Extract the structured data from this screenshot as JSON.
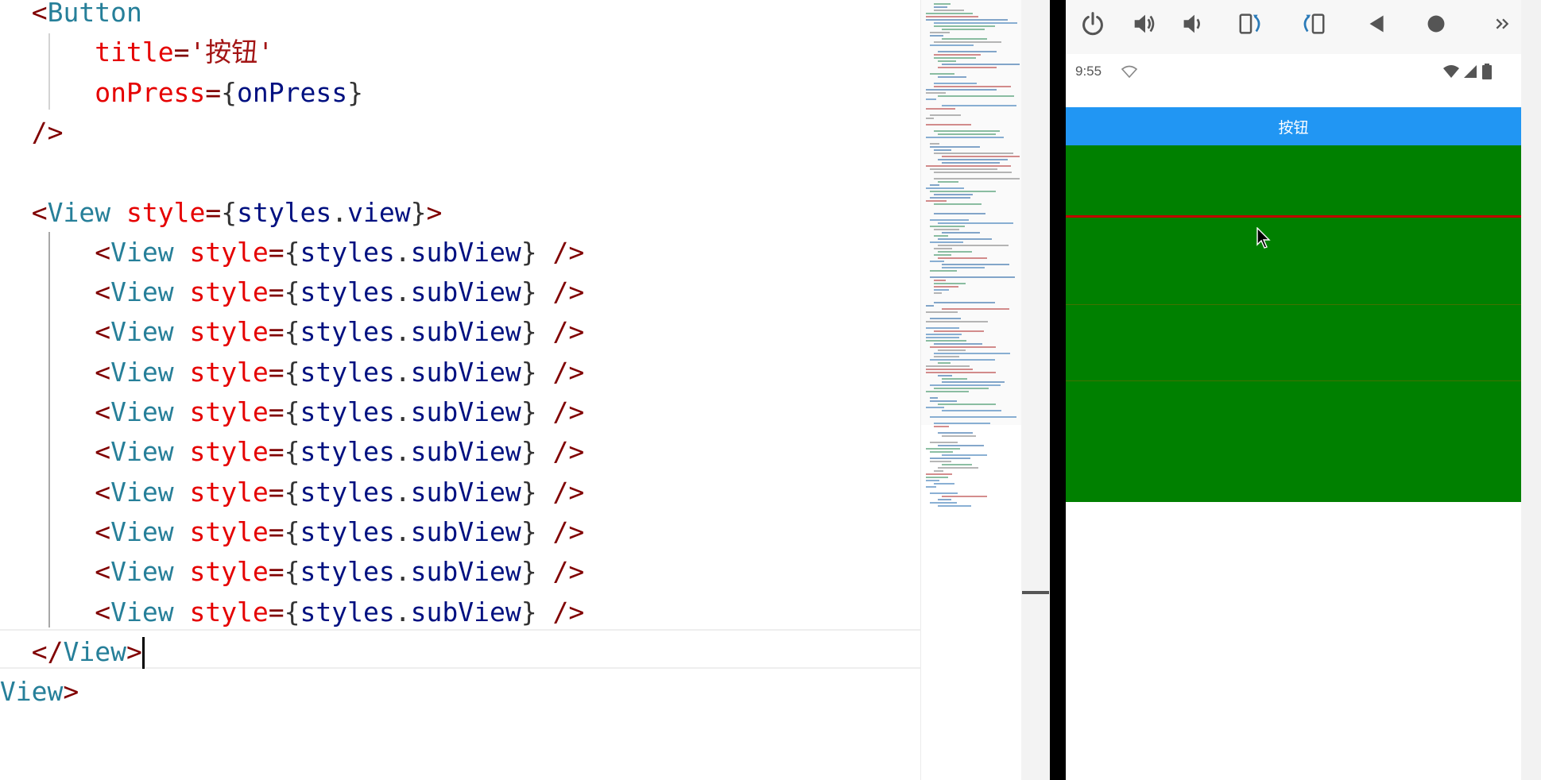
{
  "editor": {
    "lines": [
      {
        "indent": "  ",
        "tokens": [
          [
            "punc",
            "<"
          ],
          [
            "tag",
            "Button"
          ]
        ]
      },
      {
        "indent": "      ",
        "tokens": [
          [
            "attr",
            "title"
          ],
          [
            "punc",
            "="
          ],
          [
            "str",
            "'按钮'"
          ]
        ]
      },
      {
        "indent": "      ",
        "tokens": [
          [
            "attr",
            "onPress"
          ],
          [
            "punc",
            "="
          ],
          [
            "plain",
            "{"
          ],
          [
            "var",
            "onPress"
          ],
          [
            "plain",
            "}"
          ]
        ]
      },
      {
        "indent": "  ",
        "tokens": [
          [
            "punc",
            "/>"
          ]
        ]
      },
      {
        "indent": "",
        "tokens": []
      },
      {
        "indent": "  ",
        "tokens": [
          [
            "punc",
            "<"
          ],
          [
            "tag",
            "View"
          ],
          [
            "plain",
            " "
          ],
          [
            "attr",
            "style"
          ],
          [
            "punc",
            "="
          ],
          [
            "plain",
            "{"
          ],
          [
            "var",
            "styles"
          ],
          [
            "plain",
            "."
          ],
          [
            "var",
            "view"
          ],
          [
            "plain",
            "}"
          ],
          [
            "punc",
            ">"
          ]
        ]
      },
      {
        "indent": "      ",
        "tokens": [
          [
            "punc",
            "<"
          ],
          [
            "tag",
            "View"
          ],
          [
            "plain",
            " "
          ],
          [
            "attr",
            "style"
          ],
          [
            "punc",
            "="
          ],
          [
            "plain",
            "{"
          ],
          [
            "var",
            "styles"
          ],
          [
            "plain",
            "."
          ],
          [
            "var",
            "subView"
          ],
          [
            "plain",
            "}"
          ],
          [
            "plain",
            " "
          ],
          [
            "punc",
            "/>"
          ]
        ]
      },
      {
        "indent": "      ",
        "tokens": [
          [
            "punc",
            "<"
          ],
          [
            "tag",
            "View"
          ],
          [
            "plain",
            " "
          ],
          [
            "attr",
            "style"
          ],
          [
            "punc",
            "="
          ],
          [
            "plain",
            "{"
          ],
          [
            "var",
            "styles"
          ],
          [
            "plain",
            "."
          ],
          [
            "var",
            "subView"
          ],
          [
            "plain",
            "}"
          ],
          [
            "plain",
            " "
          ],
          [
            "punc",
            "/>"
          ]
        ]
      },
      {
        "indent": "      ",
        "tokens": [
          [
            "punc",
            "<"
          ],
          [
            "tag",
            "View"
          ],
          [
            "plain",
            " "
          ],
          [
            "attr",
            "style"
          ],
          [
            "punc",
            "="
          ],
          [
            "plain",
            "{"
          ],
          [
            "var",
            "styles"
          ],
          [
            "plain",
            "."
          ],
          [
            "var",
            "subView"
          ],
          [
            "plain",
            "}"
          ],
          [
            "plain",
            " "
          ],
          [
            "punc",
            "/>"
          ]
        ]
      },
      {
        "indent": "      ",
        "tokens": [
          [
            "punc",
            "<"
          ],
          [
            "tag",
            "View"
          ],
          [
            "plain",
            " "
          ],
          [
            "attr",
            "style"
          ],
          [
            "punc",
            "="
          ],
          [
            "plain",
            "{"
          ],
          [
            "var",
            "styles"
          ],
          [
            "plain",
            "."
          ],
          [
            "var",
            "subView"
          ],
          [
            "plain",
            "}"
          ],
          [
            "plain",
            " "
          ],
          [
            "punc",
            "/>"
          ]
        ]
      },
      {
        "indent": "      ",
        "tokens": [
          [
            "punc",
            "<"
          ],
          [
            "tag",
            "View"
          ],
          [
            "plain",
            " "
          ],
          [
            "attr",
            "style"
          ],
          [
            "punc",
            "="
          ],
          [
            "plain",
            "{"
          ],
          [
            "var",
            "styles"
          ],
          [
            "plain",
            "."
          ],
          [
            "var",
            "subView"
          ],
          [
            "plain",
            "}"
          ],
          [
            "plain",
            " "
          ],
          [
            "punc",
            "/>"
          ]
        ]
      },
      {
        "indent": "      ",
        "tokens": [
          [
            "punc",
            "<"
          ],
          [
            "tag",
            "View"
          ],
          [
            "plain",
            " "
          ],
          [
            "attr",
            "style"
          ],
          [
            "punc",
            "="
          ],
          [
            "plain",
            "{"
          ],
          [
            "var",
            "styles"
          ],
          [
            "plain",
            "."
          ],
          [
            "var",
            "subView"
          ],
          [
            "plain",
            "}"
          ],
          [
            "plain",
            " "
          ],
          [
            "punc",
            "/>"
          ]
        ]
      },
      {
        "indent": "      ",
        "tokens": [
          [
            "punc",
            "<"
          ],
          [
            "tag",
            "View"
          ],
          [
            "plain",
            " "
          ],
          [
            "attr",
            "style"
          ],
          [
            "punc",
            "="
          ],
          [
            "plain",
            "{"
          ],
          [
            "var",
            "styles"
          ],
          [
            "plain",
            "."
          ],
          [
            "var",
            "subView"
          ],
          [
            "plain",
            "}"
          ],
          [
            "plain",
            " "
          ],
          [
            "punc",
            "/>"
          ]
        ]
      },
      {
        "indent": "      ",
        "tokens": [
          [
            "punc",
            "<"
          ],
          [
            "tag",
            "View"
          ],
          [
            "plain",
            " "
          ],
          [
            "attr",
            "style"
          ],
          [
            "punc",
            "="
          ],
          [
            "plain",
            "{"
          ],
          [
            "var",
            "styles"
          ],
          [
            "plain",
            "."
          ],
          [
            "var",
            "subView"
          ],
          [
            "plain",
            "}"
          ],
          [
            "plain",
            " "
          ],
          [
            "punc",
            "/>"
          ]
        ]
      },
      {
        "indent": "      ",
        "tokens": [
          [
            "punc",
            "<"
          ],
          [
            "tag",
            "View"
          ],
          [
            "plain",
            " "
          ],
          [
            "attr",
            "style"
          ],
          [
            "punc",
            "="
          ],
          [
            "plain",
            "{"
          ],
          [
            "var",
            "styles"
          ],
          [
            "plain",
            "."
          ],
          [
            "var",
            "subView"
          ],
          [
            "plain",
            "}"
          ],
          [
            "plain",
            " "
          ],
          [
            "punc",
            "/>"
          ]
        ]
      },
      {
        "indent": "      ",
        "tokens": [
          [
            "punc",
            "<"
          ],
          [
            "tag",
            "View"
          ],
          [
            "plain",
            " "
          ],
          [
            "attr",
            "style"
          ],
          [
            "punc",
            "="
          ],
          [
            "plain",
            "{"
          ],
          [
            "var",
            "styles"
          ],
          [
            "plain",
            "."
          ],
          [
            "var",
            "subView"
          ],
          [
            "plain",
            "}"
          ],
          [
            "plain",
            " "
          ],
          [
            "punc",
            "/>"
          ]
        ]
      },
      {
        "indent": "  ",
        "tokens": [
          [
            "punc",
            "</"
          ],
          [
            "tag",
            "View"
          ],
          [
            "punc",
            ">"
          ]
        ],
        "cursor": true
      },
      {
        "indent": "",
        "tokens": [
          [
            "punc",
            "/"
          ],
          [
            "tag",
            "View"
          ],
          [
            "punc",
            ">"
          ]
        ]
      }
    ]
  },
  "emulator": {
    "toolbar": [
      {
        "name": "power-icon",
        "label": "power"
      },
      {
        "name": "volume-up-icon",
        "label": "volume up"
      },
      {
        "name": "volume-down-icon",
        "label": "volume down"
      },
      {
        "name": "rotate-left-icon",
        "label": "rotate left"
      },
      {
        "name": "rotate-right-icon",
        "label": "rotate right"
      },
      {
        "name": "back-icon",
        "label": "back"
      },
      {
        "name": "home-icon",
        "label": "home"
      },
      {
        "name": "more-icon",
        "label": "more"
      }
    ],
    "status_time": "9:55",
    "button_title": "按钮",
    "colors": {
      "button": "#2196f3",
      "view": "#008000",
      "subview_border": "#c00000"
    }
  }
}
